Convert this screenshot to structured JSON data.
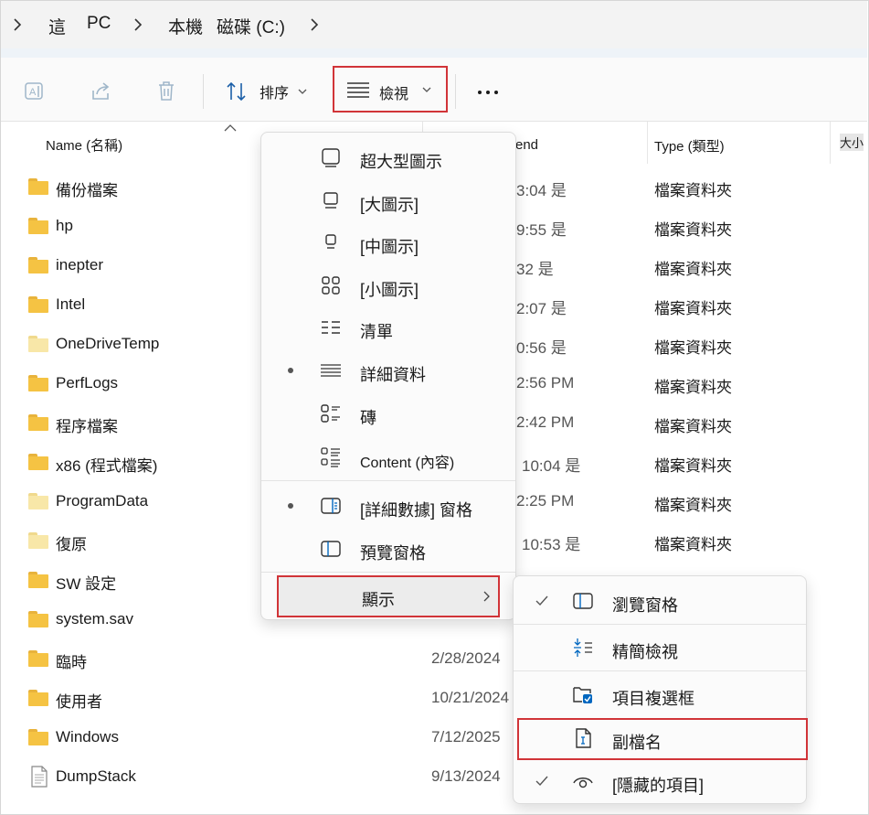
{
  "address": {
    "crumbs": [
      "這",
      "PC",
      "本機",
      "磁碟 (C:)"
    ]
  },
  "toolbar": {
    "sort_label": "排序",
    "view_label": "檢視"
  },
  "columns": {
    "name": "Name (名稱)",
    "date_partial": "end",
    "type": "Type (類型)",
    "size_partial": "大小"
  },
  "files": [
    {
      "name": "備份檔案",
      "date": "3:04 是",
      "type": "檔案資料夾",
      "icon": "folder"
    },
    {
      "name": "hp",
      "date": "9:55 是",
      "type": "檔案資料夾",
      "icon": "folder"
    },
    {
      "name": "inepter",
      "date": "32 是",
      "type": "檔案資料夾",
      "icon": "folder"
    },
    {
      "name": "Intel",
      "date": "2:07 是",
      "type": "檔案資料夾",
      "icon": "folder"
    },
    {
      "name": "OneDriveTemp",
      "date": "0:56 是",
      "type": "檔案資料夾",
      "icon": "folder-light"
    },
    {
      "name": "PerfLogs",
      "date": "2:56 PM",
      "type": "檔案資料夾",
      "icon": "folder"
    },
    {
      "name": "程序檔案",
      "date": "2:42 PM",
      "type": "檔案資料夾",
      "icon": "folder"
    },
    {
      "name": "x86 (程式檔案)",
      "date": "10:04 是",
      "type": "檔案資料夾",
      "icon": "folder"
    },
    {
      "name": "ProgramData",
      "date": "2:25 PM",
      "type": "檔案資料夾",
      "icon": "folder-light"
    },
    {
      "name": "復原",
      "date": "10:53 是",
      "type": "檔案資料夾",
      "icon": "folder-light"
    },
    {
      "name": "SW 設定",
      "date": "",
      "type": "",
      "icon": "folder"
    },
    {
      "name": "system.sav",
      "date": "",
      "type": "",
      "icon": "folder"
    },
    {
      "name": "臨時",
      "date": "2/28/2024",
      "type": "",
      "icon": "folder"
    },
    {
      "name": "使用者",
      "date": "10/21/2024",
      "type": "",
      "icon": "folder"
    },
    {
      "name": "Windows",
      "date": "7/12/2025",
      "type": "",
      "icon": "folder"
    },
    {
      "name": "DumpStack",
      "date": "9/13/2024",
      "type": "",
      "icon": "file"
    }
  ],
  "view_menu": {
    "items": [
      {
        "label": "超大型圖示",
        "icon": "extra-large-icons-icon",
        "selected": false
      },
      {
        "label": "[大圖示]",
        "icon": "large-icons-icon",
        "selected": false
      },
      {
        "label": "[中圖示]",
        "icon": "medium-icons-icon",
        "selected": false
      },
      {
        "label": "[小圖示]",
        "icon": "small-icons-icon",
        "selected": false
      },
      {
        "label": "清單",
        "icon": "list-icon",
        "selected": false
      },
      {
        "label": "詳細資料",
        "icon": "details-icon",
        "selected": true
      },
      {
        "label": "磚",
        "icon": "tiles-icon",
        "selected": false
      },
      {
        "label": "Content (內容)",
        "icon": "content-icon",
        "selected": false
      }
    ],
    "panes": [
      {
        "label": "[詳細數據] 窗格",
        "icon": "details-pane-icon",
        "selected": true
      },
      {
        "label": "預覽窗格",
        "icon": "preview-pane-icon",
        "selected": false
      }
    ],
    "show_label": "顯示"
  },
  "show_menu": {
    "items": [
      {
        "label": "瀏覽窗格",
        "icon": "navigation-pane-icon",
        "checked": true
      },
      {
        "label": "精簡檢視",
        "icon": "compact-view-icon",
        "checked": false
      },
      {
        "label": "項目複選框",
        "icon": "item-checkboxes-icon",
        "checked": false
      },
      {
        "label": "副檔名",
        "icon": "file-extensions-icon",
        "checked": false
      },
      {
        "label": "[隱藏的項目]",
        "icon": "hidden-items-icon",
        "checked": true
      }
    ]
  },
  "colors": {
    "highlight": "#d13438",
    "folder": "#f5c343",
    "accent": "#0067c0"
  }
}
